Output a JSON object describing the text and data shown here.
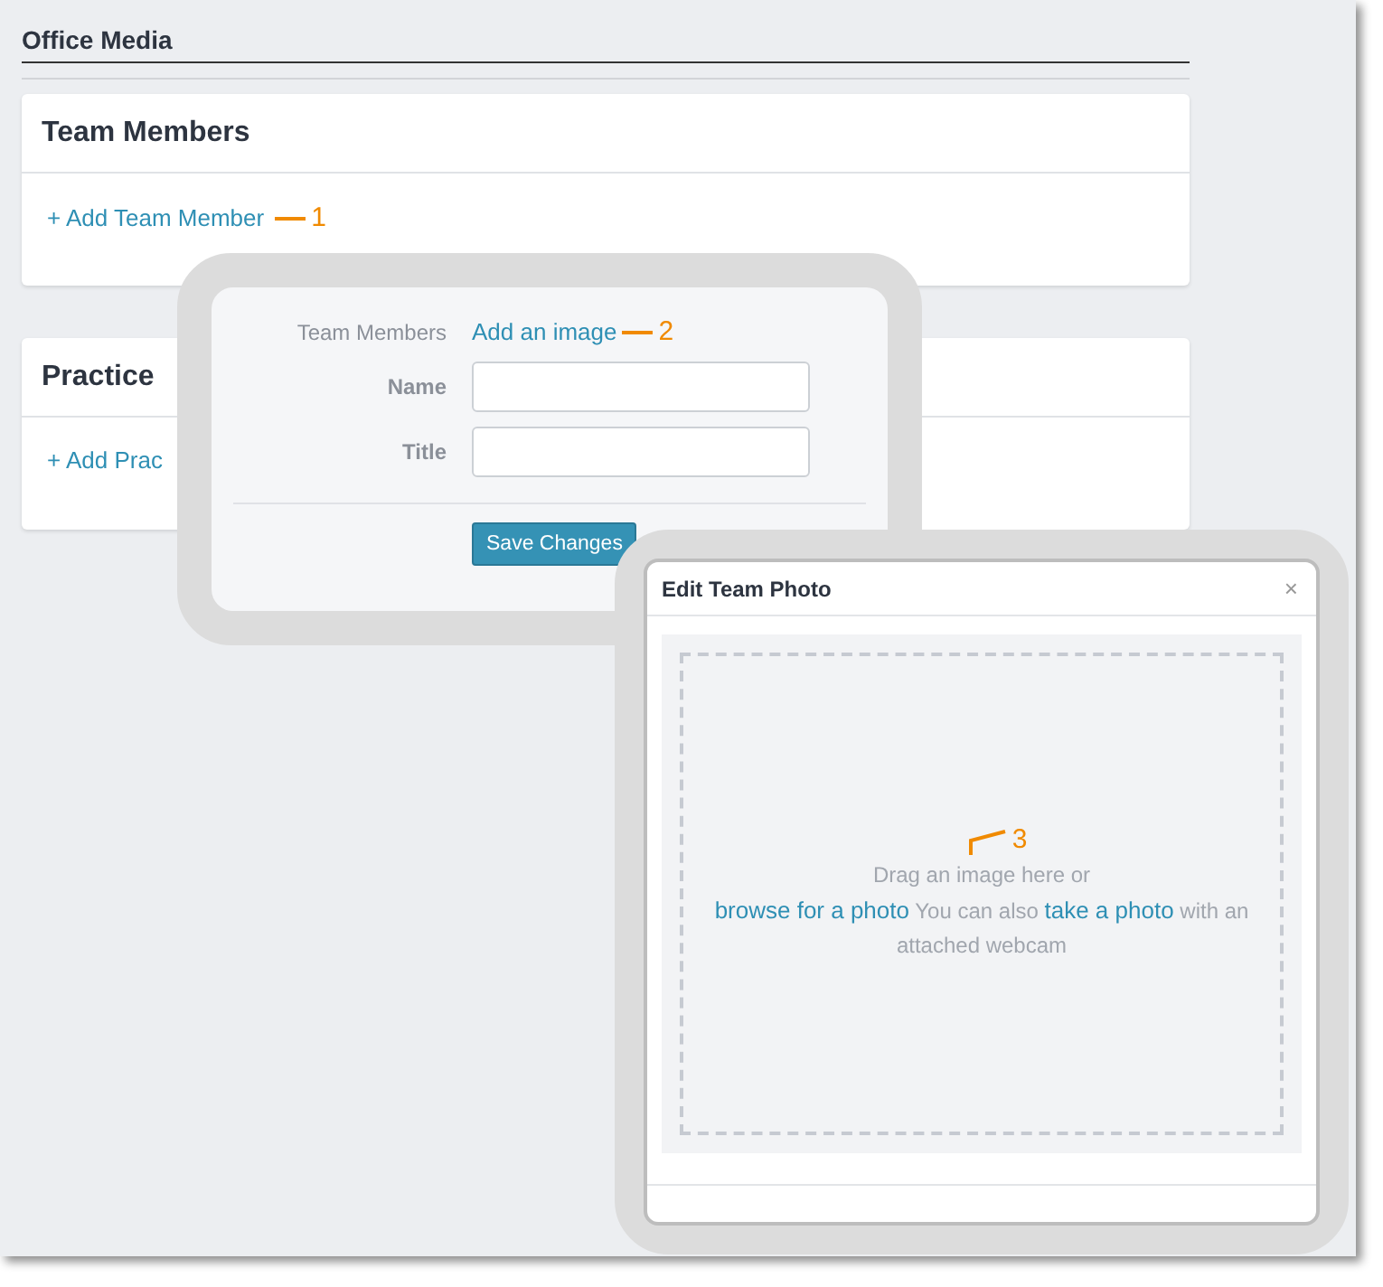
{
  "page": {
    "title": "Office Media"
  },
  "sections": [
    {
      "title": "Team Members",
      "action": "+ Add Team Member",
      "callout": "1"
    },
    {
      "title": "Practice",
      "action": "+ Add Prac"
    }
  ],
  "member_form": {
    "image_label": "Team Members",
    "image_link": "Add an image",
    "image_callout": "2",
    "fields": [
      {
        "label": "Name"
      },
      {
        "label": "Title"
      }
    ],
    "save_button": "Save Changes"
  },
  "photo_dialog": {
    "title": "Edit Team Photo",
    "close": "×",
    "drop_line": "Drag an image here or",
    "browse_link": "browse for a photo",
    "middle_text": "You can also",
    "take_link": "take a photo",
    "end_text": "with an attached webcam",
    "callout": "3"
  }
}
